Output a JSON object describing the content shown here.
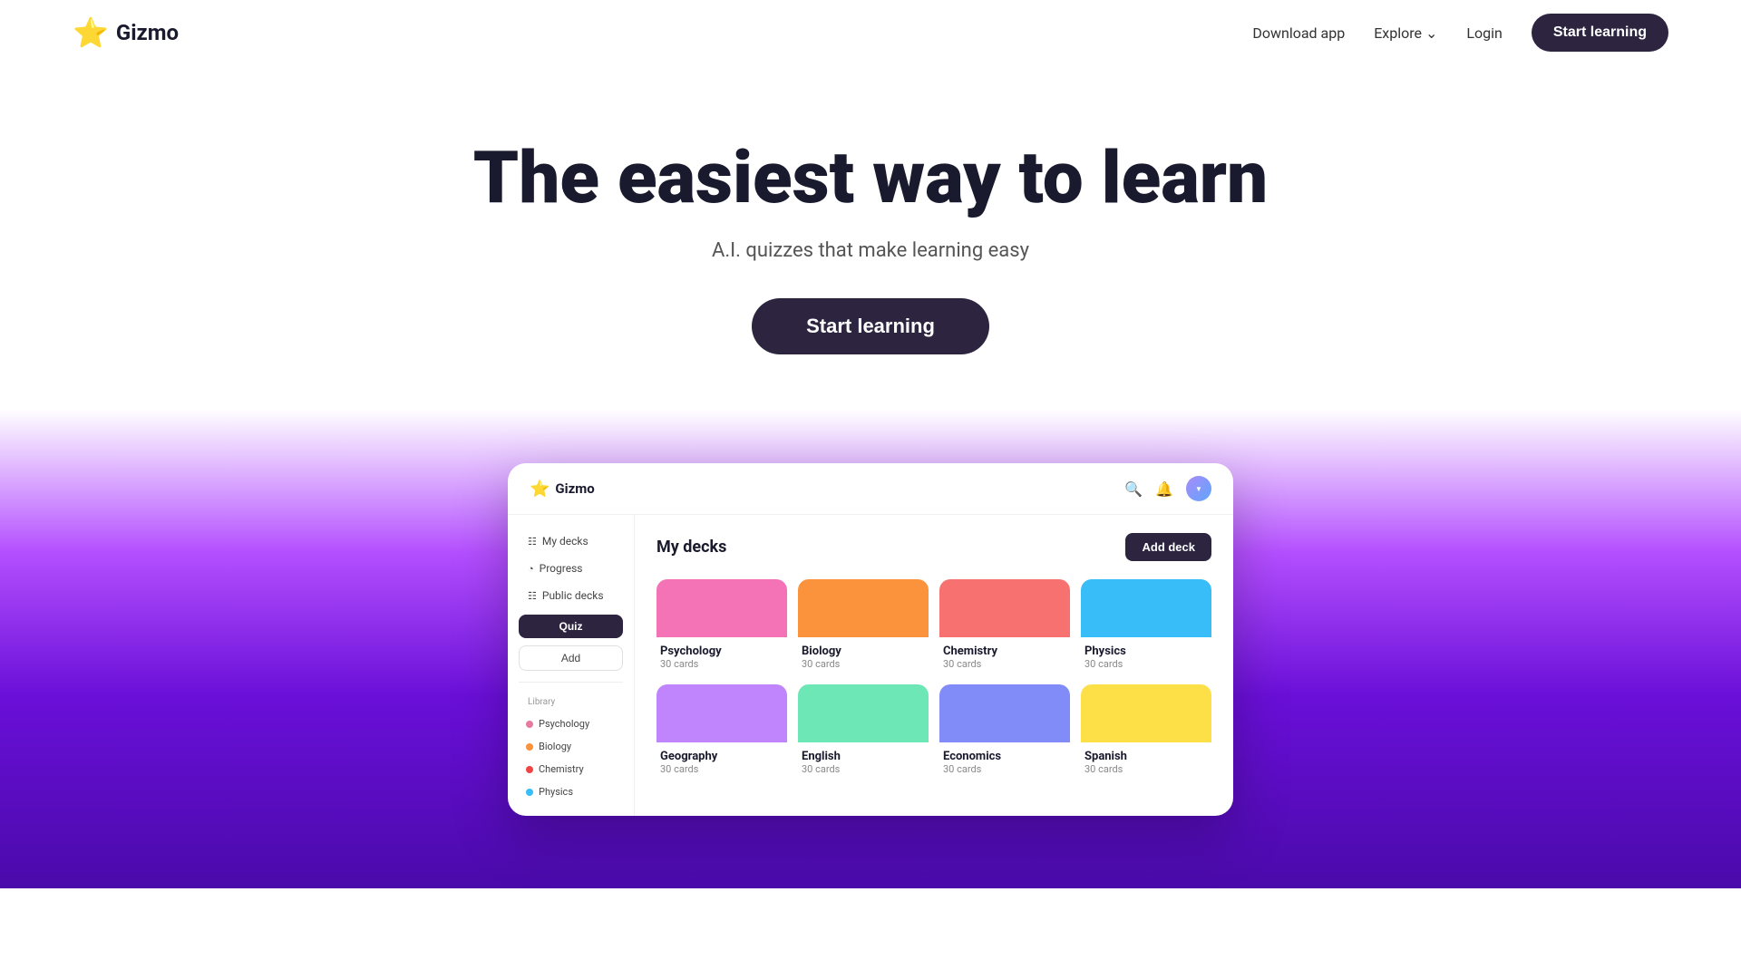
{
  "nav": {
    "logo_star": "⭐",
    "logo_text": "Gizmo",
    "download_app": "Download app",
    "explore": "Explore",
    "login": "Login",
    "start_learning": "Start learning"
  },
  "hero": {
    "title": "The easiest way to learn",
    "subtitle": "A.I. quizzes that make learning easy",
    "cta": "Start learning"
  },
  "mockup": {
    "logo_star": "⭐",
    "logo_text": "Gizmo",
    "sidebar": {
      "my_decks": "My decks",
      "progress": "Progress",
      "public_decks": "Public decks",
      "quiz_btn": "Quiz",
      "add_btn": "Add",
      "library_title": "Library",
      "library_items": [
        {
          "label": "Psychology",
          "color": "#e879a0"
        },
        {
          "label": "Biology",
          "color": "#fb923c"
        },
        {
          "label": "Chemistry",
          "color": "#ef4444"
        },
        {
          "label": "Physics",
          "color": "#38bdf8"
        }
      ]
    },
    "main": {
      "section_title": "My decks",
      "add_deck_btn": "Add deck",
      "decks": [
        {
          "name": "Psychology",
          "count": "30 cards",
          "color": "#f472b6"
        },
        {
          "name": "Biology",
          "count": "30 cards",
          "color": "#fb923c"
        },
        {
          "name": "Chemistry",
          "count": "30 cards",
          "color": "#f87171"
        },
        {
          "name": "Physics",
          "count": "30 cards",
          "color": "#38bdf8"
        },
        {
          "name": "Geography",
          "count": "30 cards",
          "color": "#c084fc"
        },
        {
          "name": "English",
          "count": "30 cards",
          "color": "#6ee7b7"
        },
        {
          "name": "Economics",
          "count": "30 cards",
          "color": "#818cf8"
        },
        {
          "name": "Spanish",
          "count": "30 cards",
          "color": "#fde047"
        }
      ]
    }
  }
}
